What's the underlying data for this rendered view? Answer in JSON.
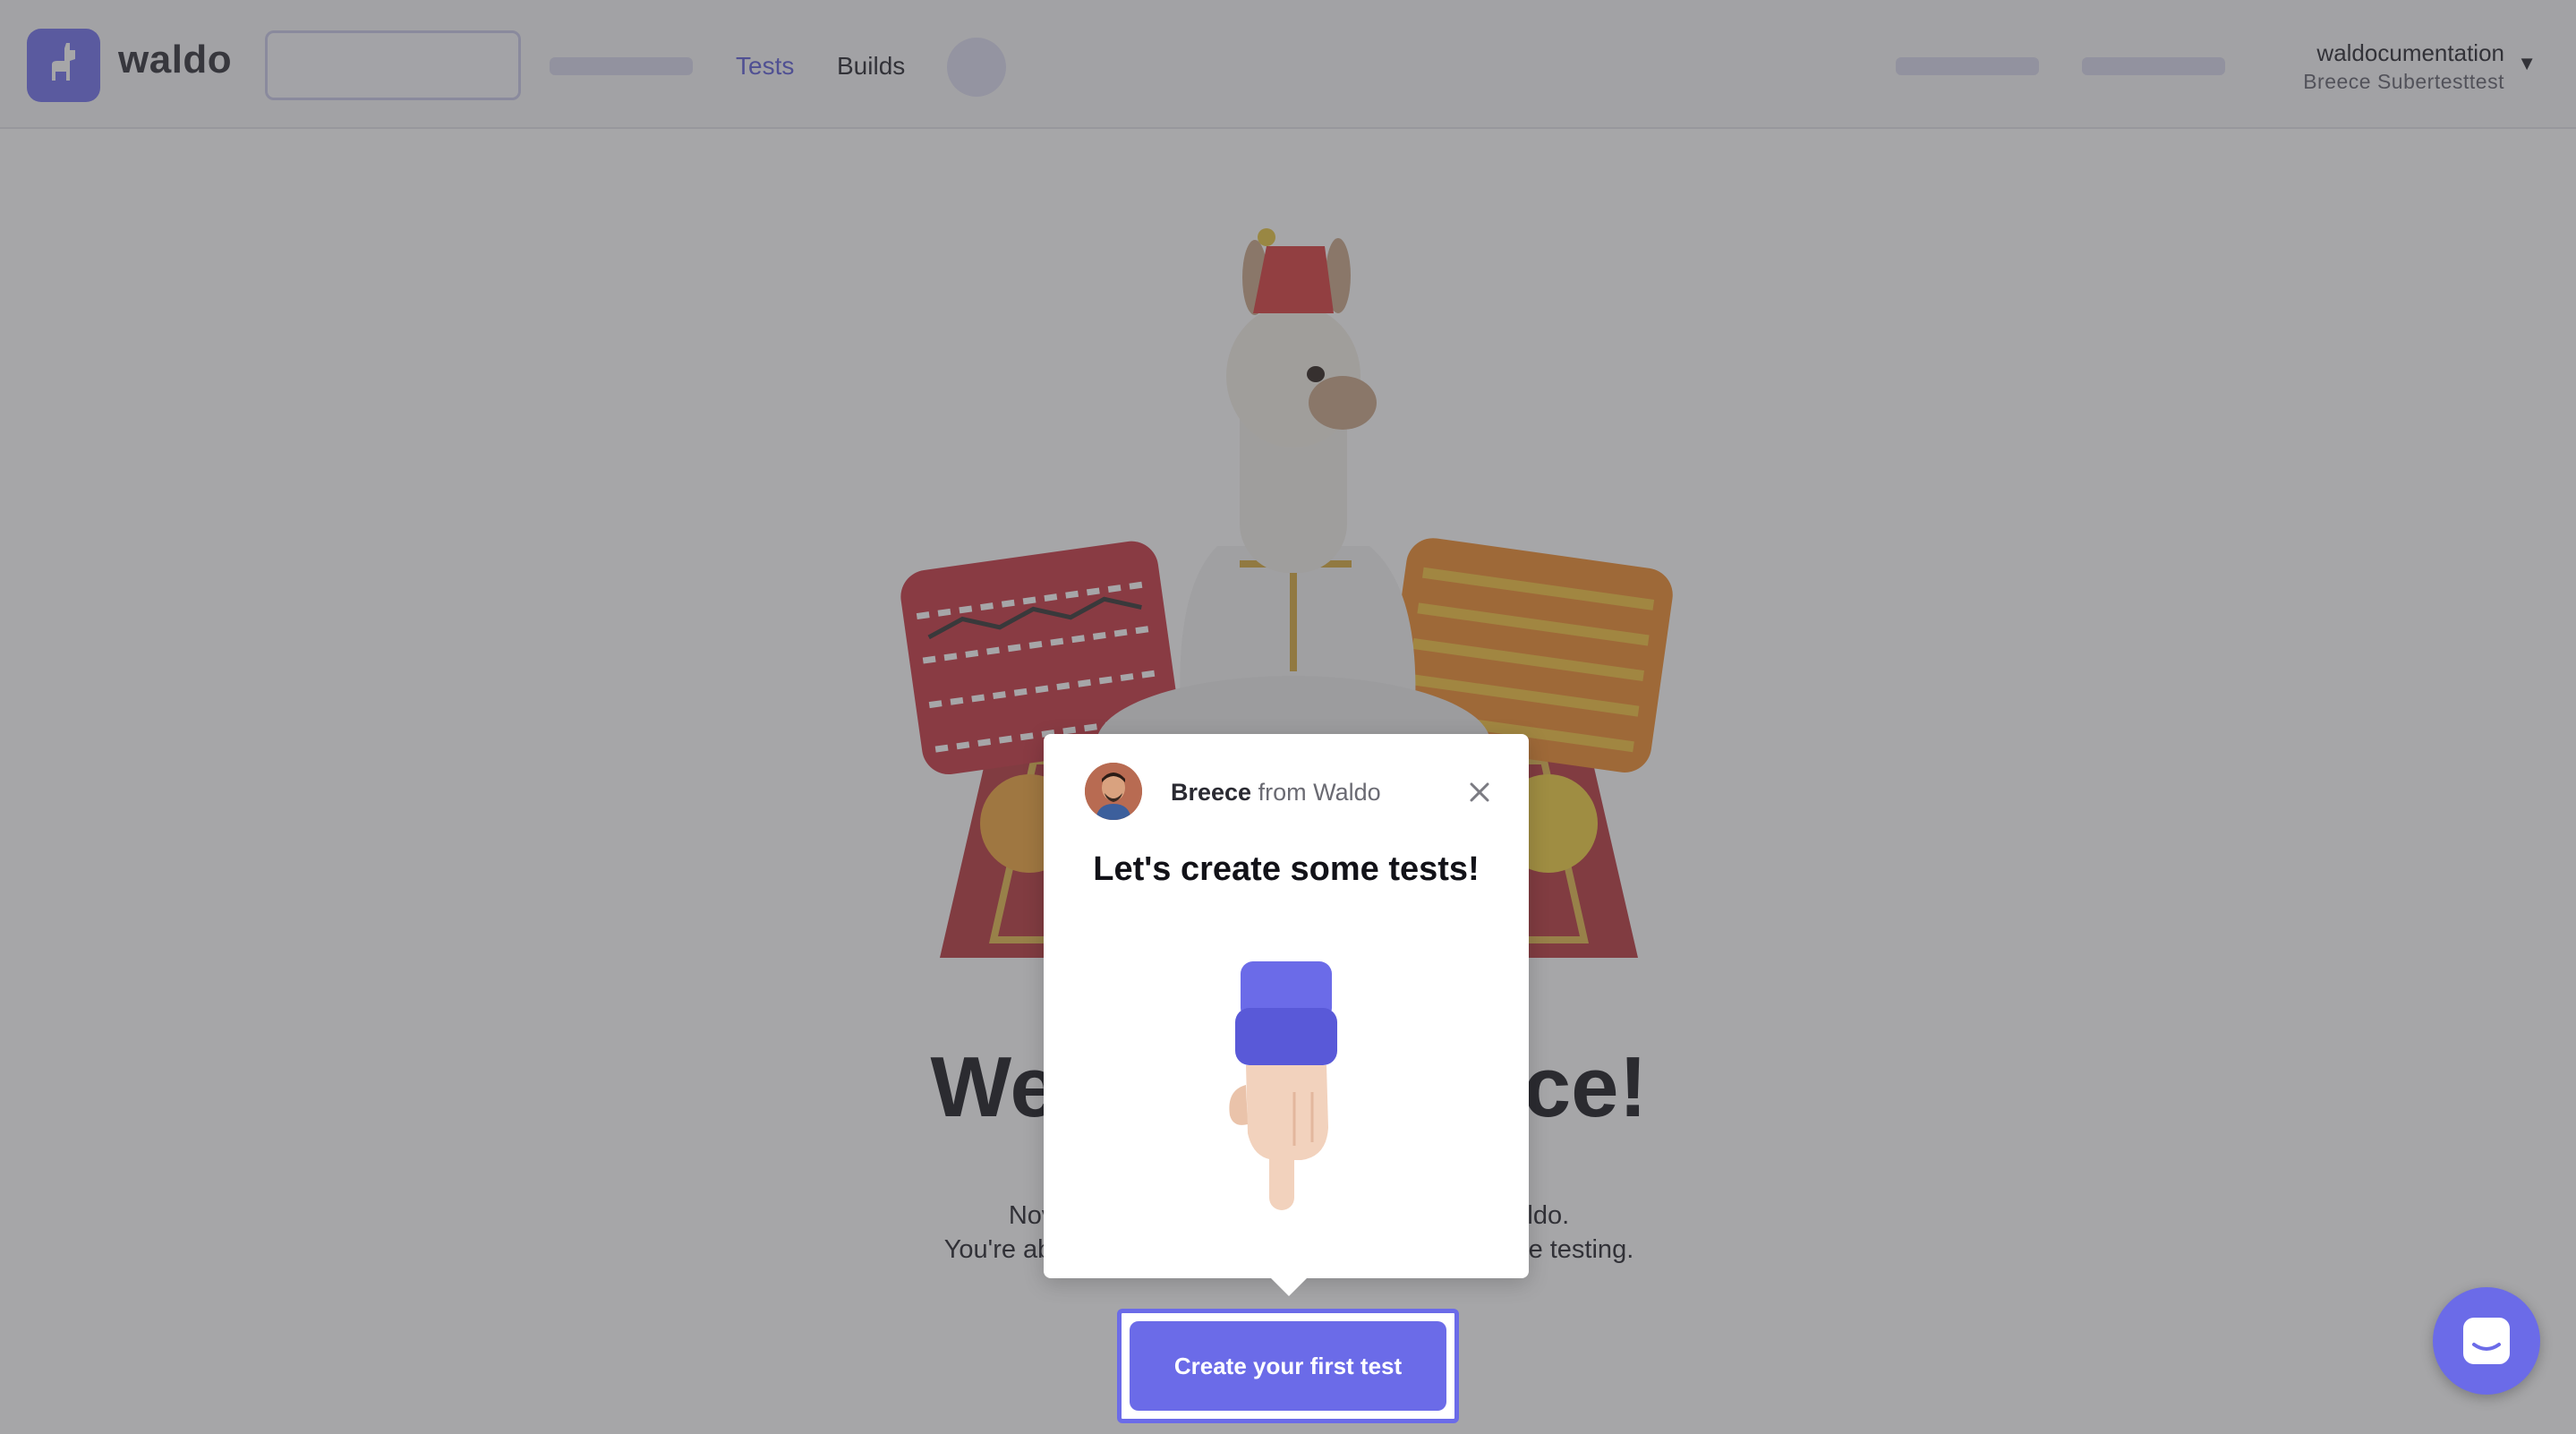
{
  "app": {
    "brand": "waldo"
  },
  "nav": {
    "tabs": [
      {
        "label": "Tests"
      },
      {
        "label": "Builds"
      }
    ],
    "account": {
      "name": "waldocumentation",
      "subtitle": "Breece Subertesttest"
    }
  },
  "welcome": {
    "heading_visible_left": "We",
    "heading_visible_right": "ce!",
    "line1_left": "Nov",
    "line1_right": "ldo.",
    "line2_left": "You're abo",
    "line2_right": "de testing."
  },
  "popup": {
    "sender_name": "Breece",
    "sender_from": " from Waldo",
    "title": "Let's create some tests!"
  },
  "cta": {
    "label": "Create your first test"
  },
  "colors": {
    "accent": "#6b6be8",
    "overlay": "rgba(70,70,74,0.48)"
  },
  "icons": [
    "waldo-llama-logo",
    "close-icon",
    "caret-down-icon",
    "pointing-hand-icon",
    "chat-icon"
  ]
}
